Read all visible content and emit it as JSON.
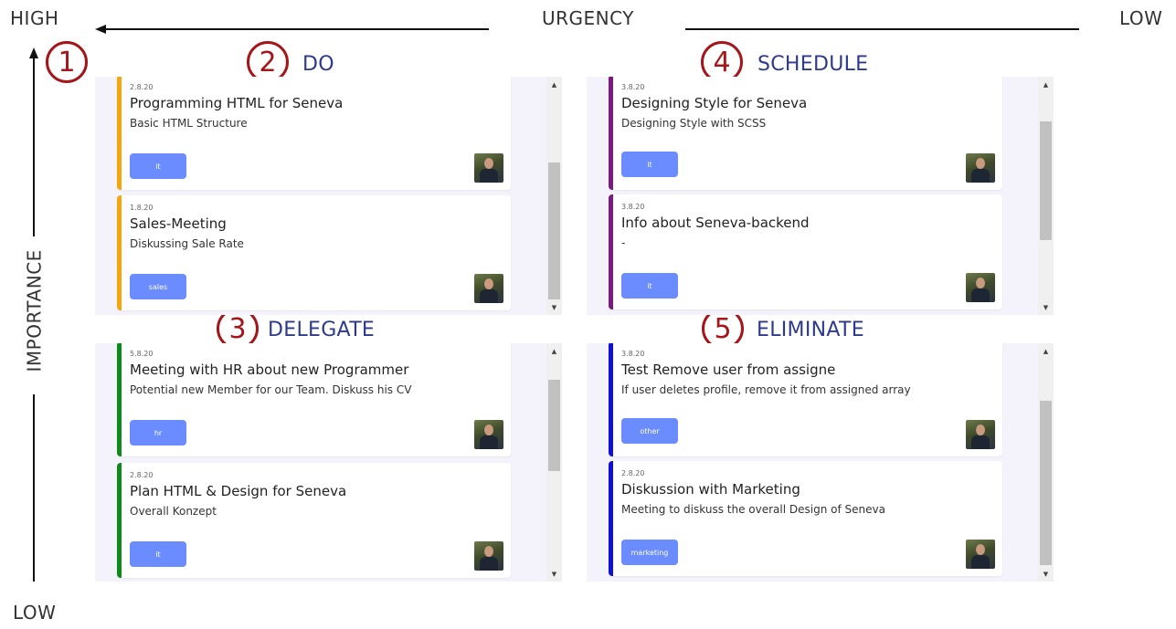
{
  "axes": {
    "high": "HIGH",
    "urgency": "URGENCY",
    "low_top": "LOW",
    "importance": "IMPORTANCE",
    "low_bottom": "LOW"
  },
  "badges": [
    "1",
    "2",
    "3",
    "4",
    "5"
  ],
  "quadrants": {
    "do": {
      "title": "DO",
      "accent": "#f5a60d",
      "cards": [
        {
          "date": "2.8.20",
          "title": "Programming HTML for Seneva",
          "desc": "Basic HTML Structure",
          "tag": "it"
        },
        {
          "date": "1.8.20",
          "title": "Sales-Meeting",
          "desc": "Diskussing Sale Rate",
          "tag": "sales"
        }
      ]
    },
    "schedule": {
      "title": "SCHEDULE",
      "accent": "#7b1a7f",
      "cards": [
        {
          "date": "3.8.20",
          "title": "Designing Style for Seneva",
          "desc": "Designing Style with SCSS",
          "tag": "it"
        },
        {
          "date": "3.8.20",
          "title": "Info about Seneva-backend",
          "desc": "-",
          "tag": "it"
        }
      ]
    },
    "delegate": {
      "title": "DELEGATE",
      "accent": "#0e8a1a",
      "cards": [
        {
          "date": "5.8.20",
          "title": "Meeting with HR about new Programmer",
          "desc": "Potential new Member for our Team. Diskuss his CV",
          "tag": "hr"
        },
        {
          "date": "2.8.20",
          "title": "Plan HTML & Design for Seneva",
          "desc": "Overall Konzept",
          "tag": "it"
        }
      ]
    },
    "eliminate": {
      "title": "ELIMINATE",
      "accent": "#1010d8",
      "cards": [
        {
          "date": "3.8.20",
          "title": "Test Remove user from assigne",
          "desc": "If user deletes profile, remove it from assigned array",
          "tag": "other"
        },
        {
          "date": "2.8.20",
          "title": "Diskussion with Marketing",
          "desc": "Meeting to diskuss the overall Design of Seneva",
          "tag": "marketing"
        }
      ]
    }
  },
  "colors": {
    "badge": "#a4161a",
    "quadrant_title": "#2d3a8c",
    "tag_bg": "#6b8cff"
  },
  "icons": {
    "arrow_left": "arrow-left-icon",
    "arrow_up": "arrow-up-icon",
    "scroll_up": "chevron-up-icon",
    "scroll_down": "chevron-down-icon",
    "avatar": "user-avatar"
  }
}
